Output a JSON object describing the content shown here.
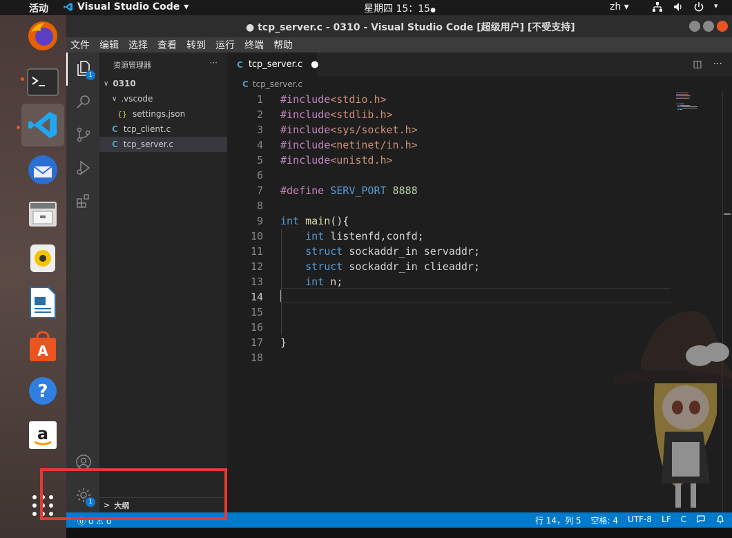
{
  "topbar": {
    "activities": "活动",
    "app_name": "Visual Studio Code",
    "app_menu_arrow": "▾",
    "clock": "星期四 15：15",
    "clock_dot": "●",
    "language": "zh ▾"
  },
  "window": {
    "title": "● tcp_server.c - 0310 - Visual Studio Code [超级用户] [不受支持]"
  },
  "menubar": [
    "文件",
    "编辑",
    "选择",
    "查看",
    "转到",
    "运行",
    "终端",
    "帮助"
  ],
  "activitybar": {
    "explorer_badge": "1",
    "settings_badge": "1"
  },
  "sidebar": {
    "header": "资源管理器",
    "more": "···",
    "tree": [
      {
        "label": "0310",
        "chevron": "∨",
        "indent": 6,
        "type": "folder"
      },
      {
        "label": ".vscode",
        "chevron": "∨",
        "indent": 18,
        "type": "folder"
      },
      {
        "label": "settings.json",
        "icon": "{}",
        "indent": 26,
        "type": "json"
      },
      {
        "label": "tcp_client.c",
        "icon": "C",
        "indent": 18,
        "type": "c"
      },
      {
        "label": "tcp_server.c",
        "icon": "C",
        "indent": 18,
        "type": "c",
        "selected": true
      }
    ],
    "outline_label": "大纲",
    "outline_chevron": ">"
  },
  "editor": {
    "tab_icon": "C",
    "tab_label": "tcp_server.c",
    "tab_dirty": "●",
    "breadcrumb_icon": "C",
    "breadcrumb": "tcp_server.c",
    "split_icon": "◫",
    "more_icon": "···",
    "line_numbers": [
      "1",
      "2",
      "3",
      "4",
      "5",
      "6",
      "7",
      "8",
      "9",
      "10",
      "11",
      "12",
      "13",
      "14",
      "15",
      "16",
      "17",
      "18"
    ],
    "current_line": 14,
    "code": {
      "l1": [
        "#include",
        "<stdio.h>"
      ],
      "l2": [
        "#include",
        "<stdlib.h>"
      ],
      "l3": [
        "#include",
        "<sys/socket.h>"
      ],
      "l4": [
        "#include",
        "<netinet/in.h>"
      ],
      "l5": [
        "#include",
        "<unistd.h>"
      ],
      "l7": [
        "#define",
        " SERV_PORT",
        " 8888"
      ],
      "l9": [
        "int",
        " main",
        "()",
        "{"
      ],
      "l10": [
        "    ",
        "int",
        " listenfd,confd;"
      ],
      "l11": [
        "    ",
        "struct",
        " sockaddr_in servaddr;"
      ],
      "l12": [
        "    ",
        "struct",
        " sockaddr_in clieaddr;"
      ],
      "l13": [
        "    ",
        "int",
        " n;"
      ],
      "l17": [
        "}"
      ]
    }
  },
  "statusbar": {
    "left": "⓪ 0 ⚠ 0",
    "position": "行 14，列 5",
    "spaces": "空格: 4",
    "encoding": "UTF-8",
    "eol": "LF",
    "language": "C"
  },
  "colors": {
    "statusbar": "#007acc",
    "highlight": "#e53935",
    "accent": "#0e7ad3"
  }
}
